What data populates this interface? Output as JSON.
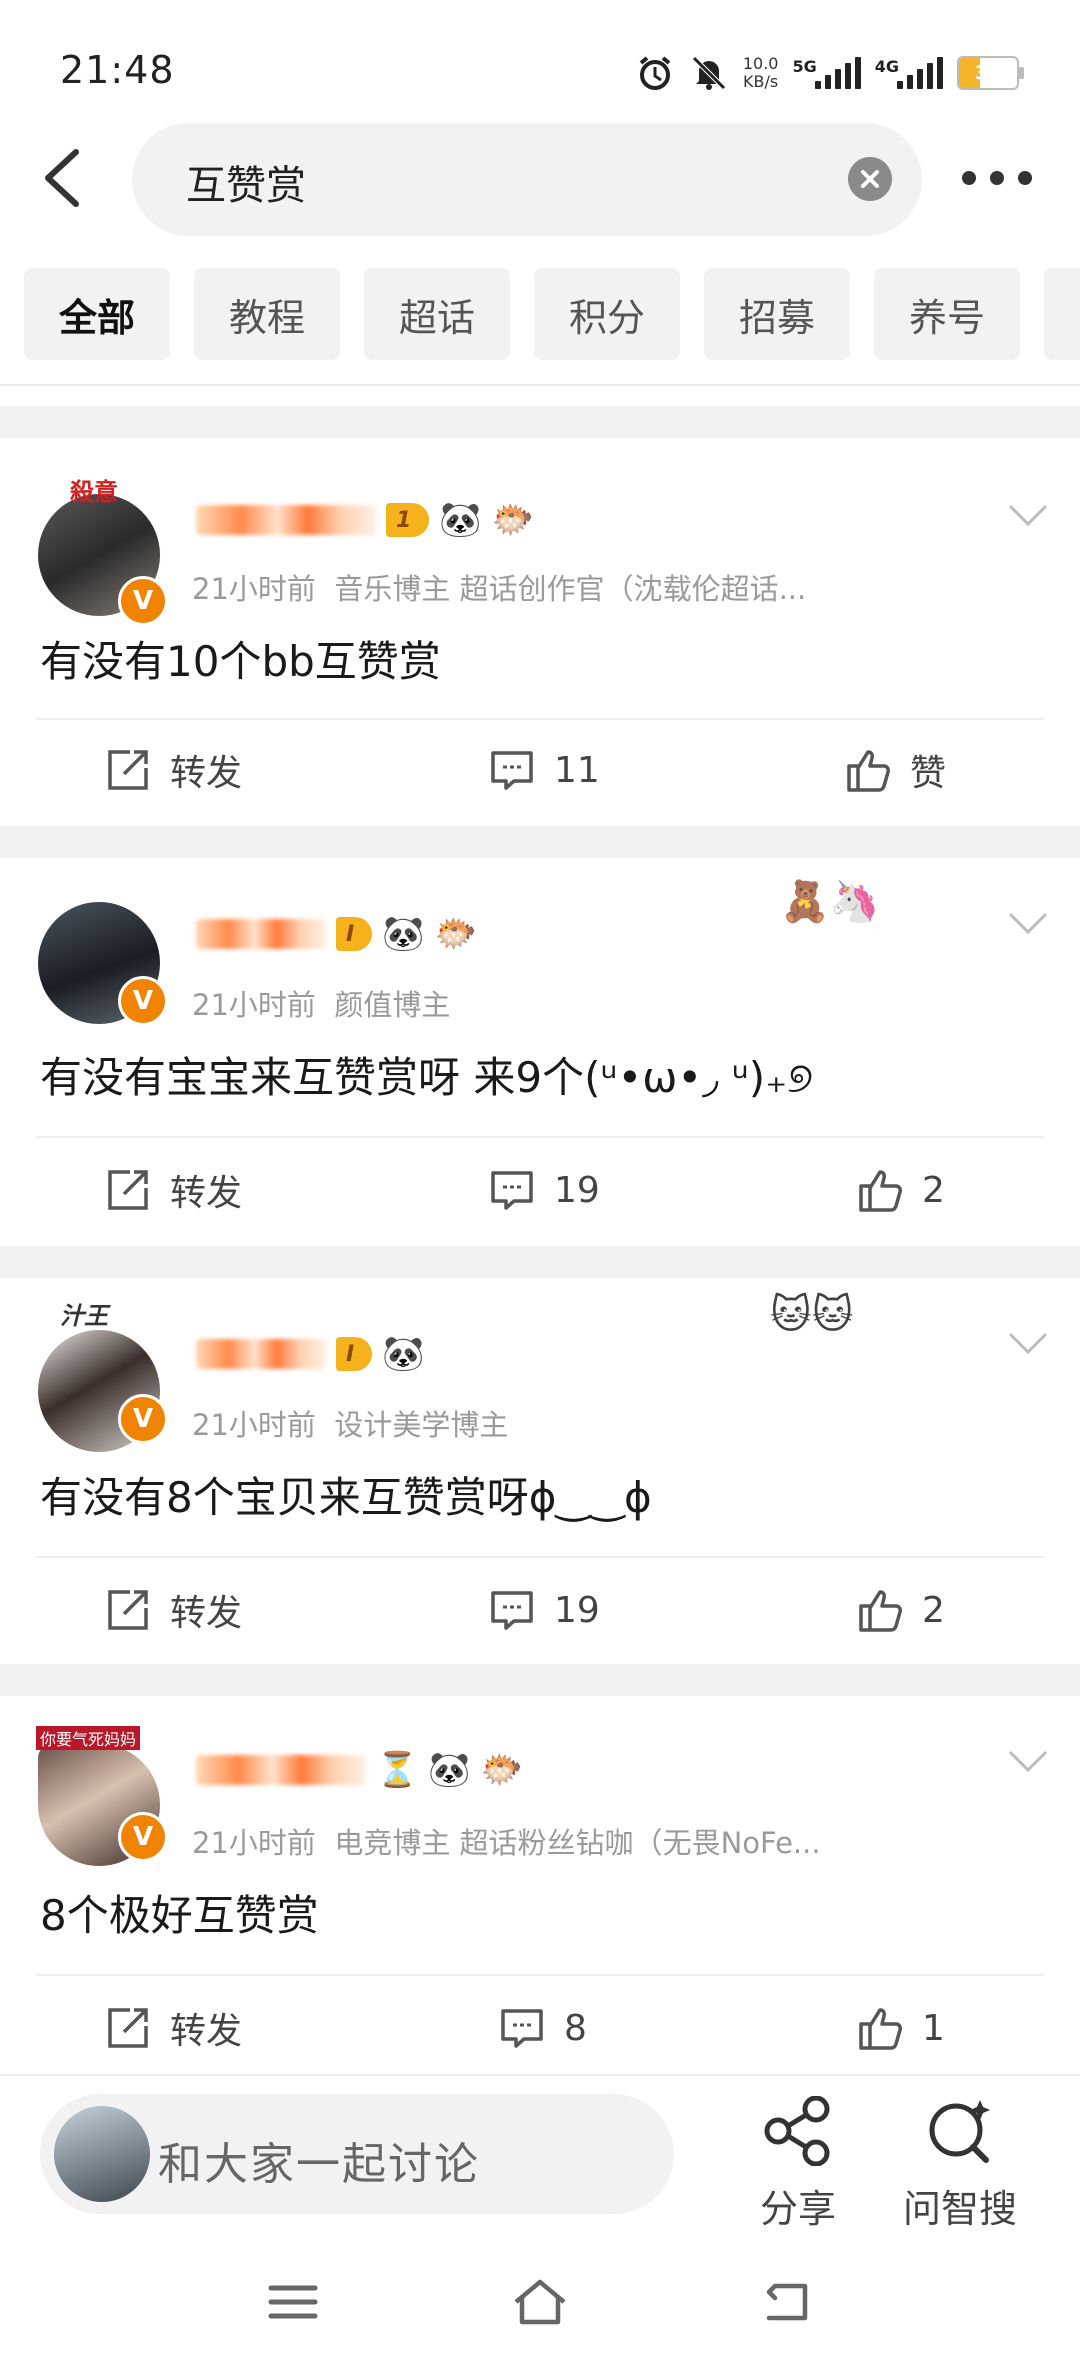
{
  "status_bar": {
    "time": "21:48",
    "net_speed_value": "10.0",
    "net_speed_unit": "KB/s",
    "sim1": "5G",
    "sim2": "4G",
    "battery": "36"
  },
  "search": {
    "query": "互赞赏"
  },
  "tabs": [
    "全部",
    "教程",
    "超话",
    "积分",
    "招募",
    "养号"
  ],
  "actions_labels": {
    "forward": "转发",
    "like_zero": "赞"
  },
  "posts": [
    {
      "frame_text": "殺意",
      "time": "21小时前",
      "meta": "音乐博主 超话创作官（沈载伦超话...",
      "text": "有没有10个bb互赞赏",
      "comments": "11",
      "likes": "赞",
      "badge": "1"
    },
    {
      "frame_text": "",
      "time": "21小时前",
      "meta": "颜值博主",
      "text": "有没有宝宝来互赞赏呀 来9个(ᵘ•ω•◞ ᵘ)₊୭",
      "comments": "19",
      "likes": "2",
      "badge": "I"
    },
    {
      "frame_text": "汁王",
      "time": "21小时前",
      "meta": "设计美学博主",
      "text": "有没有8个宝贝来互赞赏呀ɸ‿‿ɸ",
      "comments": "19",
      "likes": "2",
      "badge": "I"
    },
    {
      "frame_text": "你要气死妈妈",
      "time": "21小时前",
      "meta": "电竞博主 超话粉丝钻咖（无畏NoFe...",
      "text": "8个极好互赞赏",
      "comments": "8",
      "likes": "1",
      "badge": ""
    }
  ],
  "bottom": {
    "comment_placeholder": "和大家一起讨论",
    "share_label": "分享",
    "ask_label": "问智搜"
  },
  "colors": {
    "accent_orange": "#f08300",
    "badge_gold": "#f6b21c"
  }
}
